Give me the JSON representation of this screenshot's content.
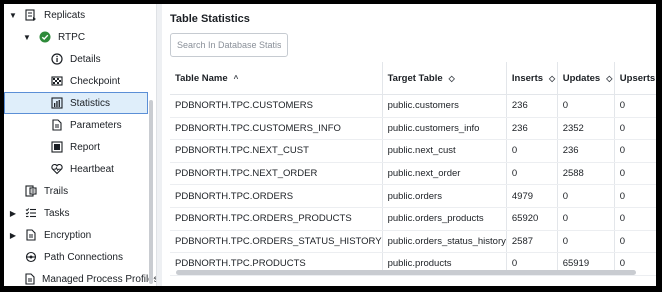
{
  "sidebar": {
    "items": [
      {
        "label": "Replicats",
        "caret": "▼",
        "icon": "replicat-icon"
      },
      {
        "label": "RTPC",
        "caret": "▼",
        "icon": "check-circle-icon"
      },
      {
        "label": "Details",
        "icon": "info-icon"
      },
      {
        "label": "Checkpoint",
        "icon": "checkpoint-icon"
      },
      {
        "label": "Statistics",
        "icon": "bar-chart-icon",
        "selected": true
      },
      {
        "label": "Parameters",
        "icon": "document-icon"
      },
      {
        "label": "Report",
        "icon": "report-icon"
      },
      {
        "label": "Heartbeat",
        "icon": "heartbeat-icon"
      },
      {
        "label": "Trails",
        "icon": "trails-icon"
      },
      {
        "label": "Tasks",
        "caret": "▶",
        "icon": "tasks-icon"
      },
      {
        "label": "Encryption",
        "caret": "▶",
        "icon": "encryption-icon"
      },
      {
        "label": "Path Connections",
        "icon": "path-icon"
      },
      {
        "label": "Managed Process Profiles",
        "icon": "profiles-icon"
      }
    ]
  },
  "main": {
    "title": "Table Statistics",
    "search_placeholder": "Search In Database Statisti",
    "columns": [
      "Table Name",
      "Target Table",
      "Inserts",
      "Updates",
      "Upserts"
    ],
    "sort_icons": [
      "^",
      "◇",
      "◇",
      "◇",
      ""
    ],
    "rows": [
      [
        "PDBNORTH.TPC.CUSTOMERS",
        "public.customers",
        "236",
        "0",
        "0"
      ],
      [
        "PDBNORTH.TPC.CUSTOMERS_INFO",
        "public.customers_info",
        "236",
        "2352",
        "0"
      ],
      [
        "PDBNORTH.TPC.NEXT_CUST",
        "public.next_cust",
        "0",
        "236",
        "0"
      ],
      [
        "PDBNORTH.TPC.NEXT_ORDER",
        "public.next_order",
        "0",
        "2588",
        "0"
      ],
      [
        "PDBNORTH.TPC.ORDERS",
        "public.orders",
        "4979",
        "0",
        "0"
      ],
      [
        "PDBNORTH.TPC.ORDERS_PRODUCTS",
        "public.orders_products",
        "65920",
        "0",
        "0"
      ],
      [
        "PDBNORTH.TPC.ORDERS_STATUS_HISTORY",
        "public.orders_status_history",
        "2587",
        "0",
        "0"
      ],
      [
        "PDBNORTH.TPC.PRODUCTS",
        "public.products",
        "0",
        "65919",
        "0"
      ]
    ]
  },
  "colors": {
    "accent": "#5b8fd6",
    "selected_bg": "#dfeefa",
    "rtpc_status": "#2e8b3a"
  }
}
